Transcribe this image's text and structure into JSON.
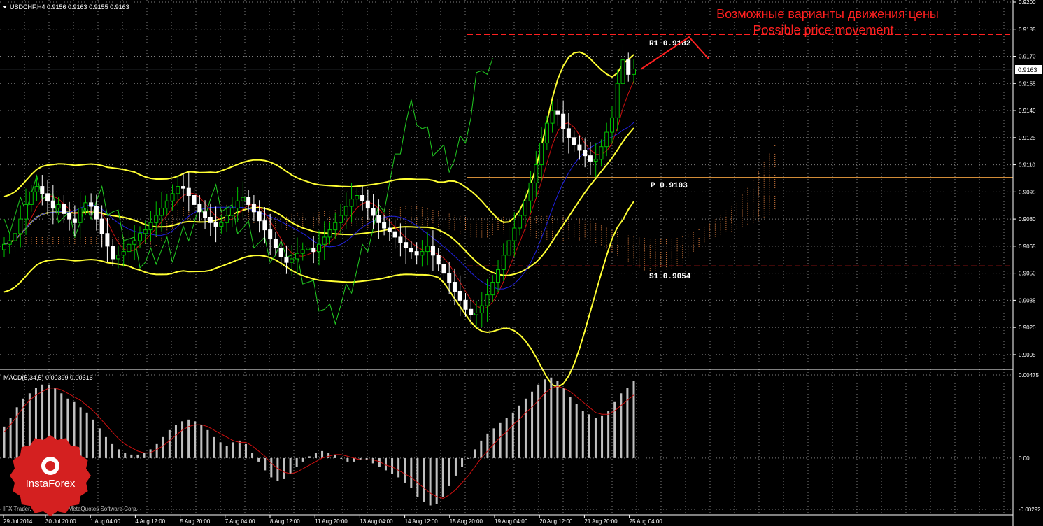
{
  "window": {
    "symbol_header": "USDCHF,H4  0.9156 0.9163 0.9155 0.9163",
    "macd_header": "MACD(5,34,5) 0.00399 0.00316",
    "copyright": "IFX Trader, © 2001-2014, MetaQuotes Software Corp.",
    "brand": "InstaForex"
  },
  "annotations": {
    "title_ru": "Возможные варианты движения цены",
    "title_en": "Possible price movement",
    "r1": "R1  0.9182",
    "p": "P  0.9103",
    "s1": "S1  0.9054",
    "current_price": "0.9163"
  },
  "colors": {
    "background": "#000000",
    "grid": "#808080",
    "bull": "#00c000",
    "bear": "#ffffff",
    "bollinger": "#ffff33",
    "ichimoku_tenkan": "#d01010",
    "ichimoku_kijun": "#2020e0",
    "chikou": "#22cc22",
    "cloud": "#e08040",
    "pivot": "#f0a040",
    "annotation_red": "#ff2020",
    "macd_hist": "#c0c0c0",
    "macd_signal": "#d01010"
  },
  "chart_data": [
    {
      "type": "candlestick",
      "title": "USDCHF,H4",
      "ylim": [
        0.8998,
        0.92
      ],
      "y_ticks": [
        "0.9200",
        "0.9185",
        "0.9170",
        "0.9155",
        "0.9140",
        "0.9125",
        "0.9110",
        "0.9095",
        "0.9080",
        "0.9065",
        "0.9050",
        "0.9035",
        "0.9020",
        "0.9005"
      ],
      "x_ticks": [
        "29 Jul 2014",
        "30 Jul 20:00",
        "1 Aug 04:00",
        "4 Aug 12:00",
        "5 Aug 20:00",
        "7 Aug 04:00",
        "8 Aug 12:00",
        "11 Aug 20:00",
        "13 Aug 04:00",
        "14 Aug 12:00",
        "15 Aug 20:00",
        "19 Aug 04:00",
        "20 Aug 12:00",
        "21 Aug 20:00",
        "25 Aug 04:00"
      ],
      "levels": {
        "R1": 0.9182,
        "P": 0.9103,
        "S1": 0.9054
      },
      "current_price": 0.9163,
      "close": [
        0.9066,
        0.9068,
        0.9072,
        0.908,
        0.9088,
        0.9095,
        0.9098,
        0.9094,
        0.909,
        0.9086,
        0.9088,
        0.9083,
        0.908,
        0.9078,
        0.9086,
        0.9089,
        0.9087,
        0.908,
        0.9072,
        0.9065,
        0.9058,
        0.906,
        0.9062,
        0.9066,
        0.9068,
        0.9072,
        0.9074,
        0.9078,
        0.9082,
        0.9086,
        0.909,
        0.9094,
        0.9098,
        0.9097,
        0.9093,
        0.9088,
        0.9084,
        0.9081,
        0.9078,
        0.9076,
        0.9078,
        0.9082,
        0.9086,
        0.909,
        0.9092,
        0.9088,
        0.9084,
        0.9079,
        0.9074,
        0.9069,
        0.9064,
        0.9059,
        0.9056,
        0.9058,
        0.9061,
        0.9063,
        0.9064,
        0.9062,
        0.9066,
        0.907,
        0.9074,
        0.9078,
        0.9082,
        0.9087,
        0.9091,
        0.9093,
        0.909,
        0.9086,
        0.9082,
        0.9078,
        0.9075,
        0.9073,
        0.907,
        0.9067,
        0.9064,
        0.9062,
        0.906,
        0.9062,
        0.9065,
        0.906,
        0.9055,
        0.905,
        0.9045,
        0.904,
        0.9035,
        0.903,
        0.9027,
        0.9028,
        0.9032,
        0.9038,
        0.9045,
        0.9052,
        0.906,
        0.9068,
        0.9075,
        0.9082,
        0.909,
        0.91,
        0.911,
        0.9122,
        0.9133,
        0.914,
        0.9138,
        0.913,
        0.9125,
        0.9121,
        0.9118,
        0.9115,
        0.9112,
        0.9113,
        0.912,
        0.9128,
        0.9136,
        0.9155,
        0.9168,
        0.916,
        0.9163
      ]
    },
    {
      "type": "bar",
      "title": "MACD(5,34,5)",
      "ylim": [
        -0.00292,
        0.00475
      ],
      "y_ticks": [
        "0.00475",
        "0.00",
        "-0.00292"
      ],
      "series": [
        {
          "name": "MACD",
          "values": [
            0.0018,
            0.0023,
            0.0029,
            0.0034,
            0.0037,
            0.004,
            0.0042,
            0.0042,
            0.004,
            0.0037,
            0.0034,
            0.0032,
            0.0029,
            0.0026,
            0.0022,
            0.0017,
            0.0012,
            0.0008,
            0.0005,
            0.0003,
            0.0002,
            0.0002,
            0.0003,
            0.0005,
            0.0008,
            0.0012,
            0.0016,
            0.0019,
            0.0021,
            0.0022,
            0.0021,
            0.0019,
            0.0016,
            0.0012,
            0.0009,
            0.0007,
            0.0009,
            0.001,
            0.0008,
            0.0003,
            -0.0002,
            -0.0007,
            -0.0011,
            -0.0013,
            -0.0012,
            -0.0009,
            -0.0005,
            -0.0002,
            0.0001,
            0.0003,
            0.0004,
            0.0003,
            0.0002,
            0.0,
            -0.0002,
            -0.0002,
            -0.0001,
            -0.0001,
            -0.0003,
            -0.0005,
            -0.0007,
            -0.0009,
            -0.0011,
            -0.0014,
            -0.0017,
            -0.0022,
            -0.0025,
            -0.0027,
            -0.0026,
            -0.0022,
            -0.0016,
            -0.001,
            -0.0005,
            0.0,
            0.0005,
            0.001,
            0.0014,
            0.0017,
            0.002,
            0.0023,
            0.0026,
            0.003,
            0.0034,
            0.0038,
            0.0042,
            0.0045,
            0.0046,
            0.0044,
            0.004,
            0.0035,
            0.0031,
            0.0027,
            0.0025,
            0.0023,
            0.0024,
            0.0027,
            0.0032,
            0.0037,
            0.004,
            0.0044
          ]
        },
        {
          "name": "Signal",
          "values": [
            0.0015,
            0.0019,
            0.0024,
            0.0029,
            0.0033,
            0.0036,
            0.0038,
            0.004,
            0.004,
            0.0039,
            0.0037,
            0.0035,
            0.0033,
            0.003,
            0.0027,
            0.0023,
            0.0019,
            0.0015,
            0.0011,
            0.0008,
            0.0006,
            0.0004,
            0.0003,
            0.0003,
            0.0005,
            0.0007,
            0.001,
            0.0013,
            0.0016,
            0.0018,
            0.0019,
            0.0019,
            0.0018,
            0.0016,
            0.0014,
            0.0012,
            0.001,
            0.0009,
            0.0009,
            0.0007,
            0.0004,
            0.0001,
            -0.0003,
            -0.0006,
            -0.0008,
            -0.0009,
            -0.0008,
            -0.0006,
            -0.0004,
            -0.0002,
            0.0,
            0.0001,
            0.0002,
            0.0002,
            0.0001,
            0.0,
            -0.0001,
            -0.0001,
            -0.0001,
            -0.0002,
            -0.0004,
            -0.0005,
            -0.0007,
            -0.0009,
            -0.0011,
            -0.0014,
            -0.0017,
            -0.002,
            -0.0022,
            -0.0023,
            -0.0021,
            -0.0018,
            -0.0014,
            -0.001,
            -0.0005,
            0.0,
            0.0004,
            0.0008,
            0.0012,
            0.0015,
            0.0019,
            0.0022,
            0.0026,
            0.0029,
            0.0033,
            0.0037,
            0.004,
            0.0041,
            0.004,
            0.0038,
            0.0035,
            0.0032,
            0.0029,
            0.0026,
            0.0025,
            0.0025,
            0.0027,
            0.003,
            0.0033,
            0.0036
          ]
        }
      ]
    }
  ]
}
